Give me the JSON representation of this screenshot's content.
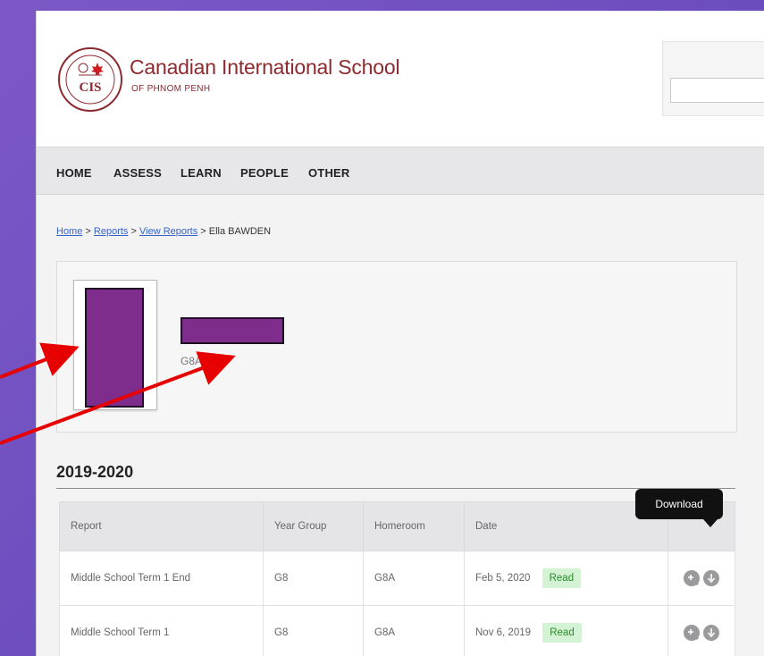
{
  "header": {
    "school_name": "Canadian International School",
    "school_sub": "OF PHNOM PENH",
    "logo_text": "CIS",
    "search_placeholder": ""
  },
  "nav": {
    "items": [
      "HOME",
      "ASSESS",
      "LEARN",
      "PEOPLE",
      "OTHER"
    ]
  },
  "breadcrumb": {
    "home": "Home",
    "reports": "Reports",
    "view_reports": "View Reports",
    "student": "Ella BAWDEN",
    "separator": ">"
  },
  "profile": {
    "homeroom": "G8A"
  },
  "year_section": {
    "title": "2019-2020",
    "columns": [
      "Report",
      "Year Group",
      "Homeroom",
      "Date",
      ""
    ],
    "rows": [
      {
        "report": "Middle School Term 1 End",
        "year_group": "G8",
        "homeroom": "G8A",
        "date": "Feb 5, 2020",
        "status": "Read"
      },
      {
        "report": "Middle School Term 1",
        "year_group": "G8",
        "homeroom": "G8A",
        "date": "Nov 6, 2019",
        "status": "Read"
      }
    ]
  },
  "tooltip": "Download",
  "colors": {
    "brand": "#8d2a2f",
    "redaction": "#7e2d8d",
    "annotation_arrow": "#e60000",
    "read_badge_bg": "#d4f3d4",
    "read_badge_text": "#2c8a2c"
  }
}
